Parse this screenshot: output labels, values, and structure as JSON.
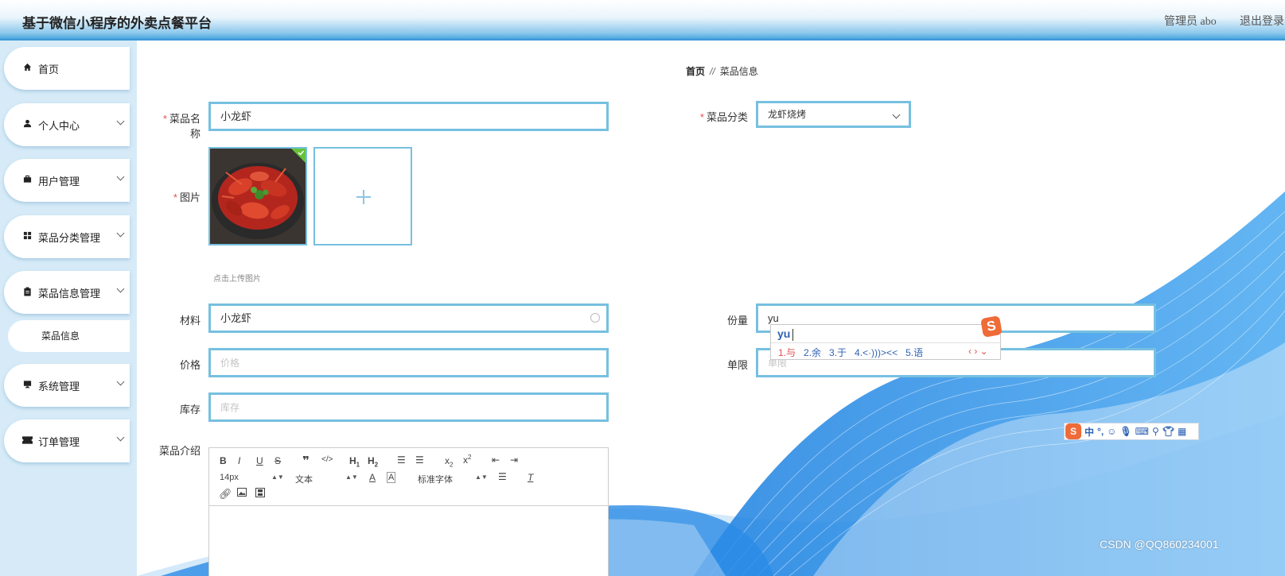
{
  "header": {
    "title": "基于微信小程序的外卖点餐平台",
    "admin_label": "管理员 abo",
    "logout_label": "退出登录"
  },
  "sidebar": {
    "items": [
      {
        "label": "首页",
        "icon": "home-icon"
      },
      {
        "label": "个人中心",
        "icon": "user-icon"
      },
      {
        "label": "用户管理",
        "icon": "briefcase-icon"
      },
      {
        "label": "菜品分类管理",
        "icon": "grid-icon"
      },
      {
        "label": "菜品信息管理",
        "icon": "clipboard-icon"
      },
      {
        "label": "系统管理",
        "icon": "monitor-icon"
      },
      {
        "label": "订单管理",
        "icon": "ticket-icon"
      }
    ],
    "sub_item": "菜品信息"
  },
  "breadcrumb": {
    "home": "首页",
    "separator": "//",
    "current": "菜品信息"
  },
  "form": {
    "name": {
      "label": "菜品名称",
      "value": "小龙虾"
    },
    "category": {
      "label": "菜品分类",
      "value": "龙虾烧烤"
    },
    "image": {
      "label": "图片",
      "hint": "点击上传图片"
    },
    "material": {
      "label": "材料",
      "value": "小龙虾"
    },
    "portion": {
      "label": "份量",
      "value": "yu"
    },
    "price": {
      "label": "价格",
      "placeholder": "价格"
    },
    "limit": {
      "label": "单限",
      "placeholder": "单限"
    },
    "stock": {
      "label": "库存",
      "placeholder": "库存"
    },
    "intro": {
      "label": "菜品介绍"
    }
  },
  "editor": {
    "font_size": "14px",
    "text_type": "文本",
    "font_family": "标准字体"
  },
  "ime": {
    "composition": "yu",
    "candidates": [
      "1.与",
      "2.余",
      "3.于",
      "4.<·)))><<",
      "5.语"
    ],
    "toolbar_mode": "中"
  },
  "watermark": "CSDN @QQ860234001",
  "colors": {
    "accent": "#76c0e0",
    "header_blue": "#4aa6de",
    "sidebar_bg": "#d6ebf7",
    "required": "#e15050"
  }
}
